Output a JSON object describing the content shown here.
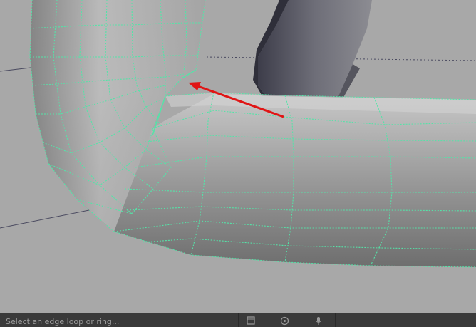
{
  "viewport": {
    "name": "3D modeling viewport",
    "wireframe_color": "#55e3a8",
    "annotation_arrow_color": "#e01515"
  },
  "statusbar": {
    "help_text": "Select an edge loop or ring...",
    "icons": [
      "panel-icon",
      "target-icon",
      "microphone-icon"
    ]
  }
}
